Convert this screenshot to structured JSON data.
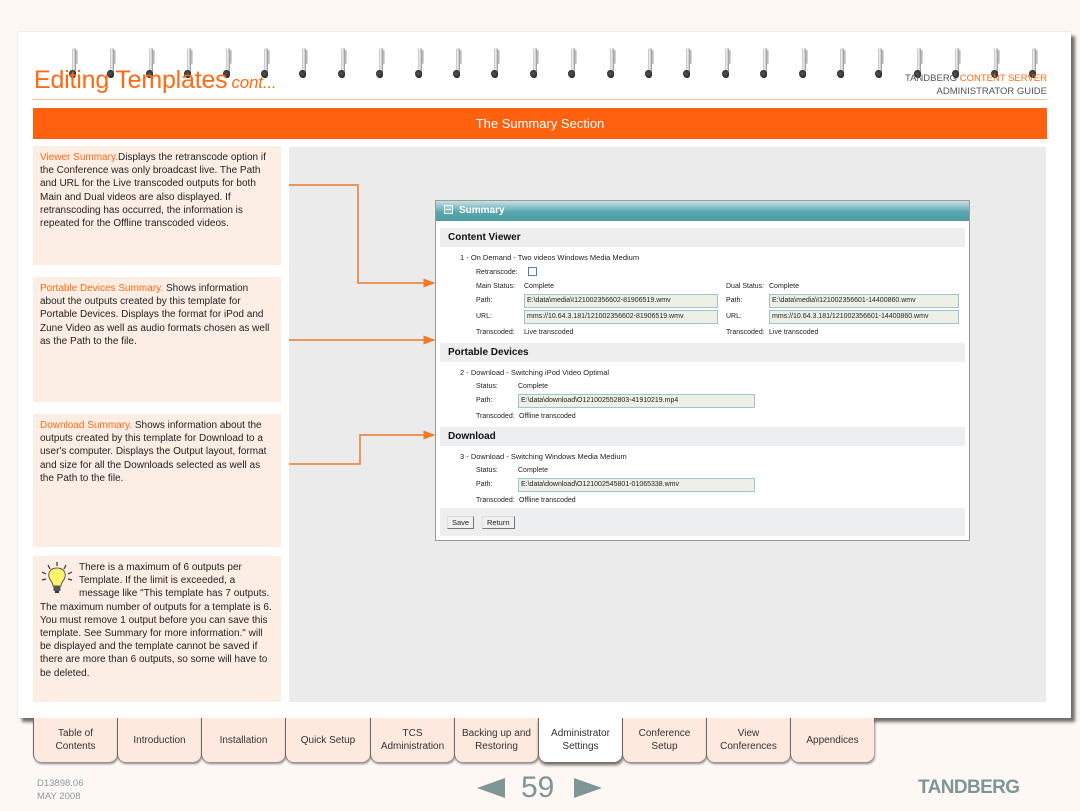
{
  "header": {
    "title": "Editing Templates",
    "title_suffix": "cont...",
    "brand_prefix": "TANDBERG",
    "brand_accent": "CONTENT SERVER",
    "brand_line2": "ADMINISTRATOR GUIDE"
  },
  "section_bar": {
    "title": "The Summary Section"
  },
  "notes": [
    {
      "lead": "Viewer Summary.",
      "body": "Displays the retranscode option if the Conference was only broadcast live. The Path and URL for the Live transcoded outputs for both Main and Dual videos are also displayed. If retranscoding has occurred, the information is repeated for the Offline transcoded videos."
    },
    {
      "lead": "Portable Devices Summary.",
      "body": " Shows information about the outputs created by this template for Portable Devices. Displays the format for iPod and Zune Video as well as audio formats chosen as well as the Path to the file."
    },
    {
      "lead": "Download Summary.",
      "body": " Shows information about the outputs created by this template for Download to a user's computer. Displays the Output layout, format and size for all the Downloads selected as well as the Path to the file."
    }
  ],
  "tip": {
    "icon": "lightbulb-icon",
    "text": "There is a maximum of 6 outputs per Template. If the limit is exceeded, a message like \"This template has 7 outputs. The maximum number of outputs for a template is 6. You must remove 1 output before you can save this template. See Summary for more information.\" will be displayed and the template cannot be saved if there are more than 6 outputs, so some will have to be deleted."
  },
  "summary_panel": {
    "title": "Summary",
    "content_viewer": {
      "heading": "Content Viewer",
      "item": "1 - On Demand - Two videos Windows Media Medium",
      "retranscode_label": "Retranscode:",
      "retranscode_checked": false,
      "main_status_label": "Main Status:",
      "main_status": "Complete",
      "dual_status_label": "Dual Status:",
      "dual_status": "Complete",
      "path_label": "Path:",
      "url_label": "URL:",
      "transcoded_label": "Transcoded:",
      "main_path": "E:\\data\\media\\I121002356602-81906519.wmv",
      "main_url": "mms://10.64.3.181/121002356602-81906519.wmv",
      "main_transcoded": "Live transcoded",
      "dual_path": "E:\\data\\media\\I121002356601-14400860.wmv",
      "dual_url": "mms://10.64.3.181/121002356601-14400860.wmv",
      "dual_transcoded": "Live transcoded"
    },
    "portable_devices": {
      "heading": "Portable Devices",
      "item": "2 - Download - Switching iPod Video Optimal",
      "status_label": "Status:",
      "status": "Complete",
      "path_label": "Path:",
      "path": "E:\\data\\download\\O121002552803-41910219.mp4",
      "transcoded_label": "Transcoded:",
      "transcoded": "Offline transcoded"
    },
    "download": {
      "heading": "Download",
      "item": "3 - Download - Switching Windows Media Medium",
      "status_label": "Status:",
      "status": "Complete",
      "path_label": "Path:",
      "path": "E:\\data\\download\\O121002545801-01065338.wmv",
      "transcoded_label": "Transcoded:",
      "transcoded": "Offline transcoded"
    },
    "buttons": {
      "save": "Save",
      "return": "Return"
    }
  },
  "nav_tabs": [
    {
      "label": "Table of\nContents",
      "active": false
    },
    {
      "label": "Introduction",
      "active": false
    },
    {
      "label": "Installation",
      "active": false
    },
    {
      "label": "Quick Setup",
      "active": false
    },
    {
      "label": "TCS\nAdministration",
      "active": false
    },
    {
      "label": "Backing up and\nRestoring",
      "active": false
    },
    {
      "label": "Administrator\nSettings",
      "active": true
    },
    {
      "label": "Conference\nSetup",
      "active": false
    },
    {
      "label": "View\nConferences",
      "active": false
    },
    {
      "label": "Appendices",
      "active": false
    }
  ],
  "footer": {
    "doc_number": "D13898.06",
    "date": "MAY 2008",
    "page_number": "59",
    "logo": "TANDBERG"
  },
  "colors": {
    "accent": "#ff6a13",
    "section_bar": "#ff610f",
    "note_bg": "#fdeee5",
    "panel_header": "#5aa6af",
    "footer_gray": "#7f9696"
  }
}
